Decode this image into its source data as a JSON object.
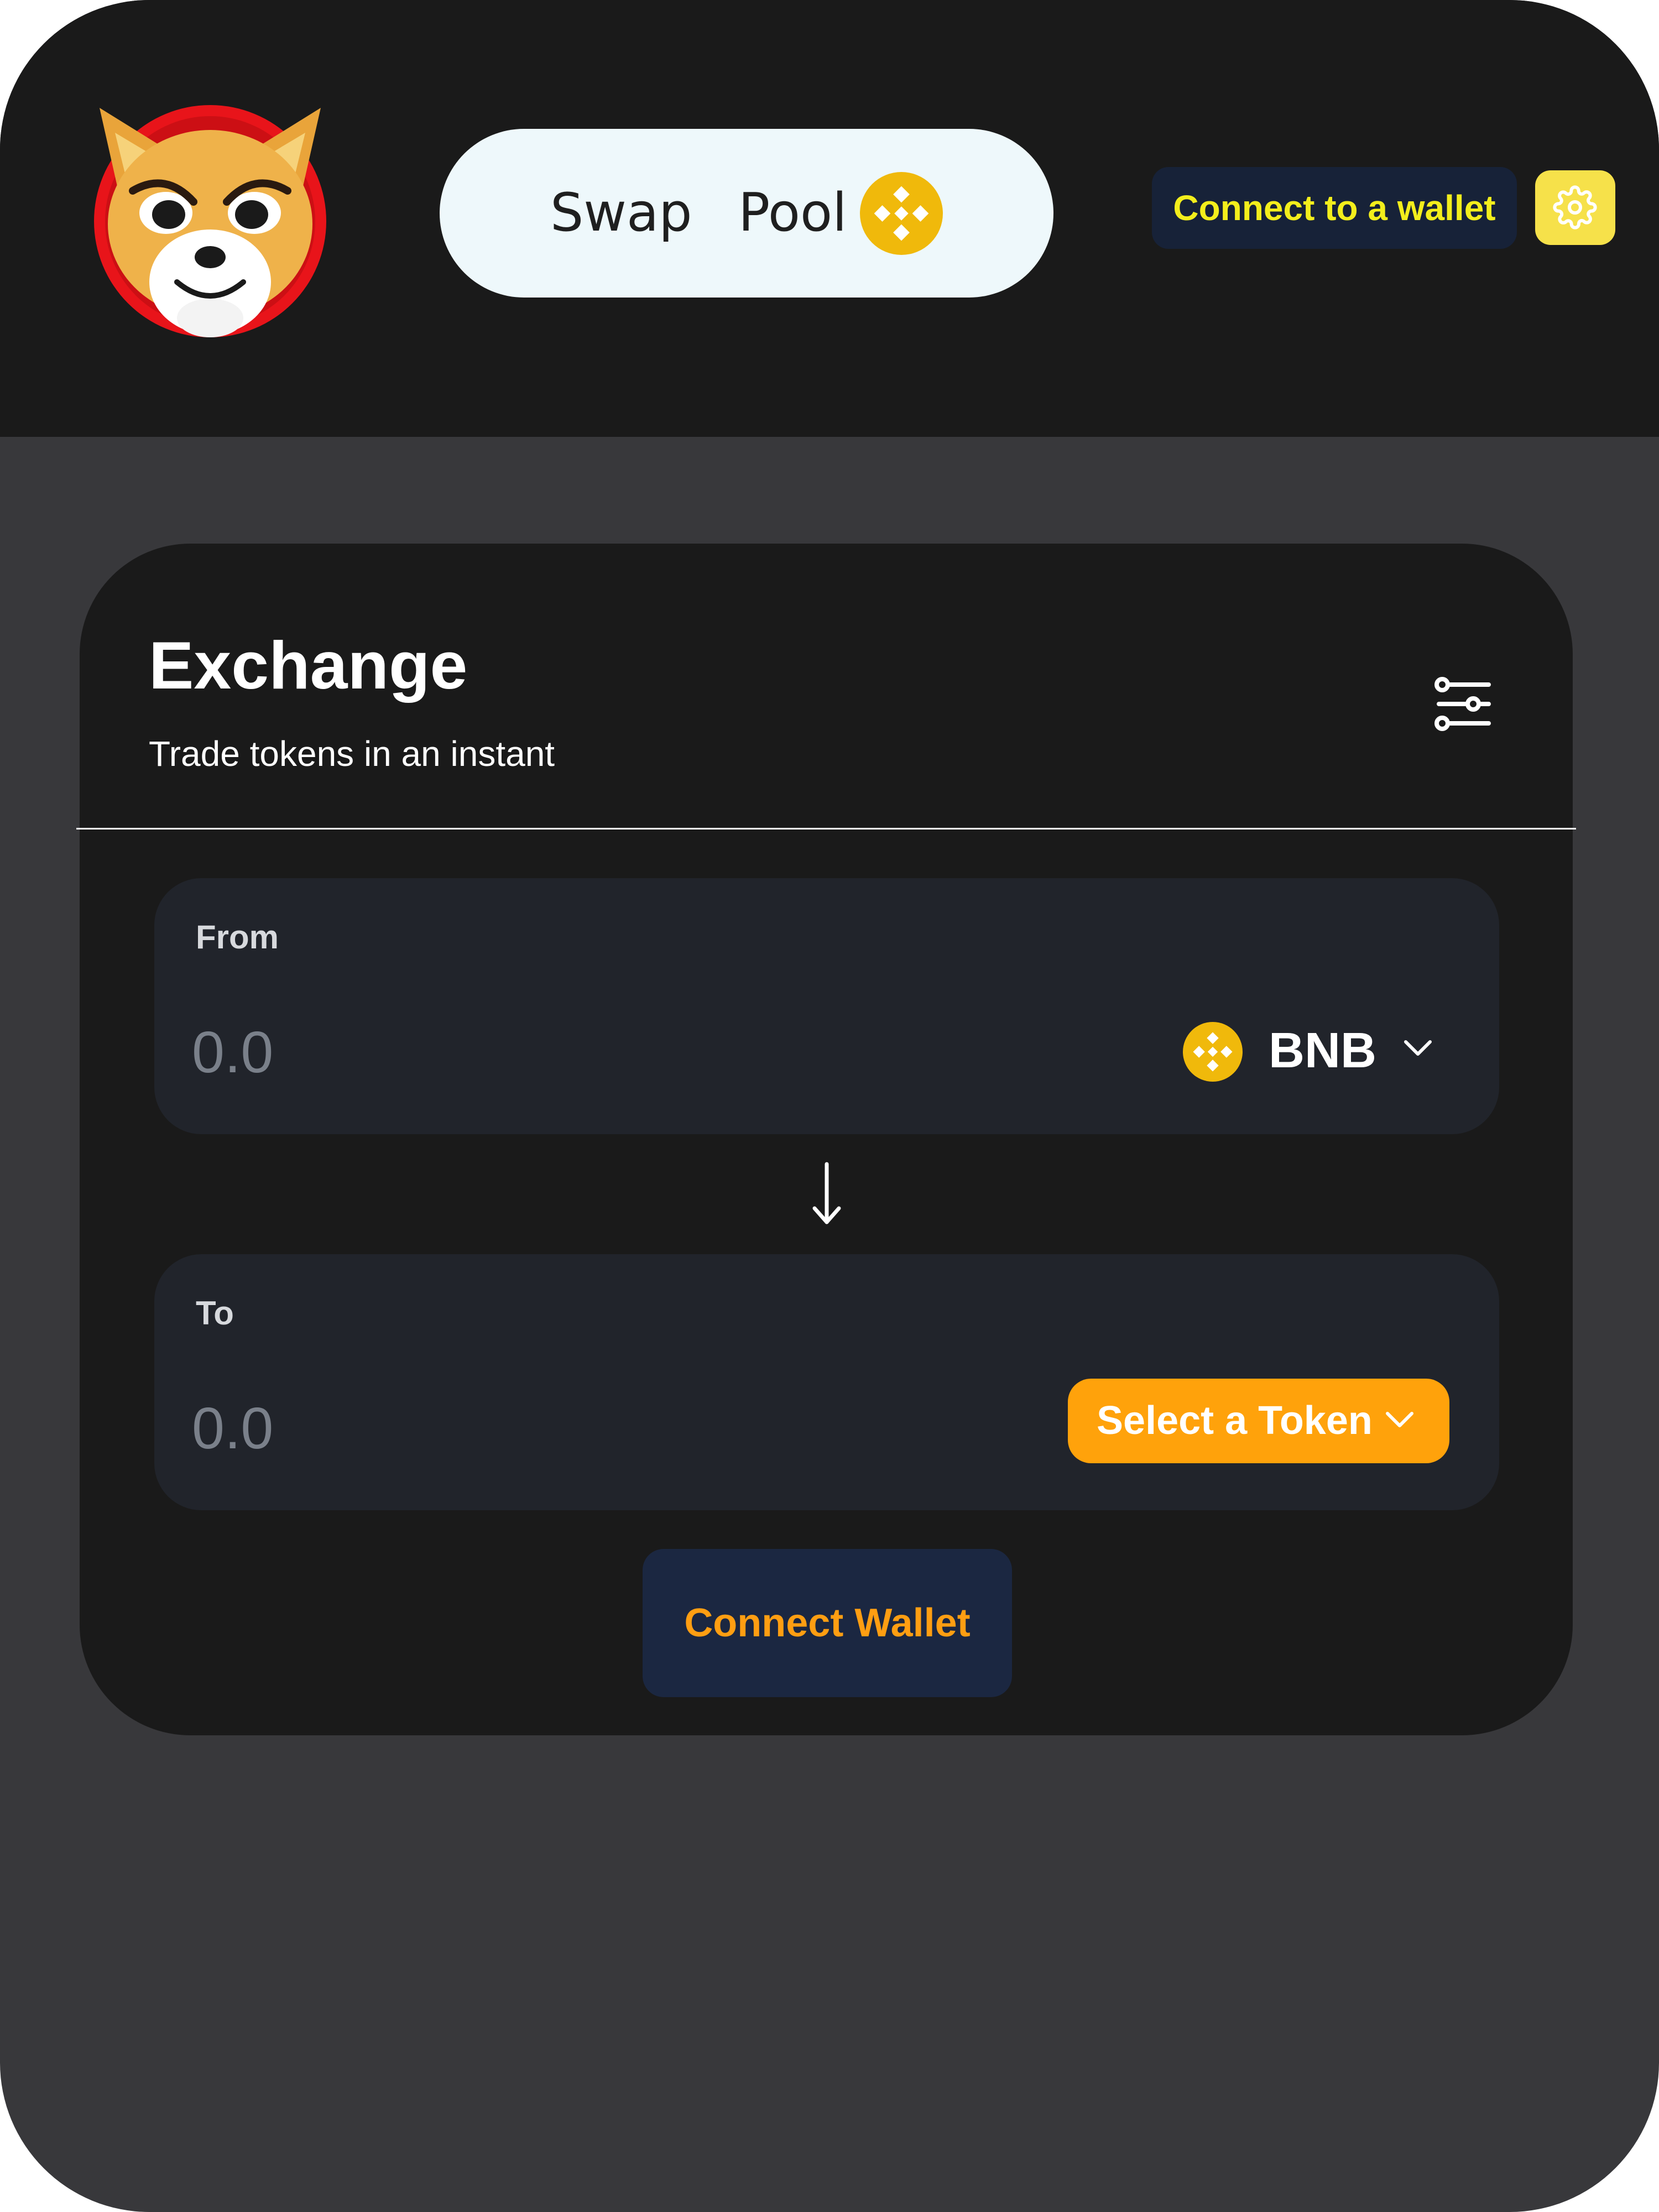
{
  "header": {
    "nav": [
      {
        "label": "Swap"
      },
      {
        "label": "Pool"
      }
    ],
    "connect_label": "Connect to a wallet"
  },
  "exchange": {
    "title": "Exchange",
    "subtitle": "Trade tokens in an instant",
    "from": {
      "label": "From",
      "amount_placeholder": "0.0",
      "token_symbol": "BNB"
    },
    "to": {
      "label": "To",
      "amount_placeholder": "0.0",
      "select_label": "Select a Token"
    },
    "connect_wallet_label": "Connect Wallet"
  },
  "colors": {
    "accent_orange": "#ffa20b",
    "connect_text_yellow": "#f3ee1c",
    "bnb_yellow": "#f0b90b",
    "settings_button_yellow": "#f6e14a",
    "nav_pill_bg": "#eef8fb",
    "card_bg": "#1a1a1a",
    "panel_bg": "#21242b",
    "page_bg": "#38383b"
  },
  "icons": {
    "logo": "shiba-inu-mascot-logo",
    "nav_token": "bnb-icon",
    "settings": "gear-icon",
    "exchange_settings": "sliders-icon",
    "from_token": "bnb-icon",
    "dropdown": "chevron-down-icon",
    "swap_direction": "arrow-down-icon"
  }
}
